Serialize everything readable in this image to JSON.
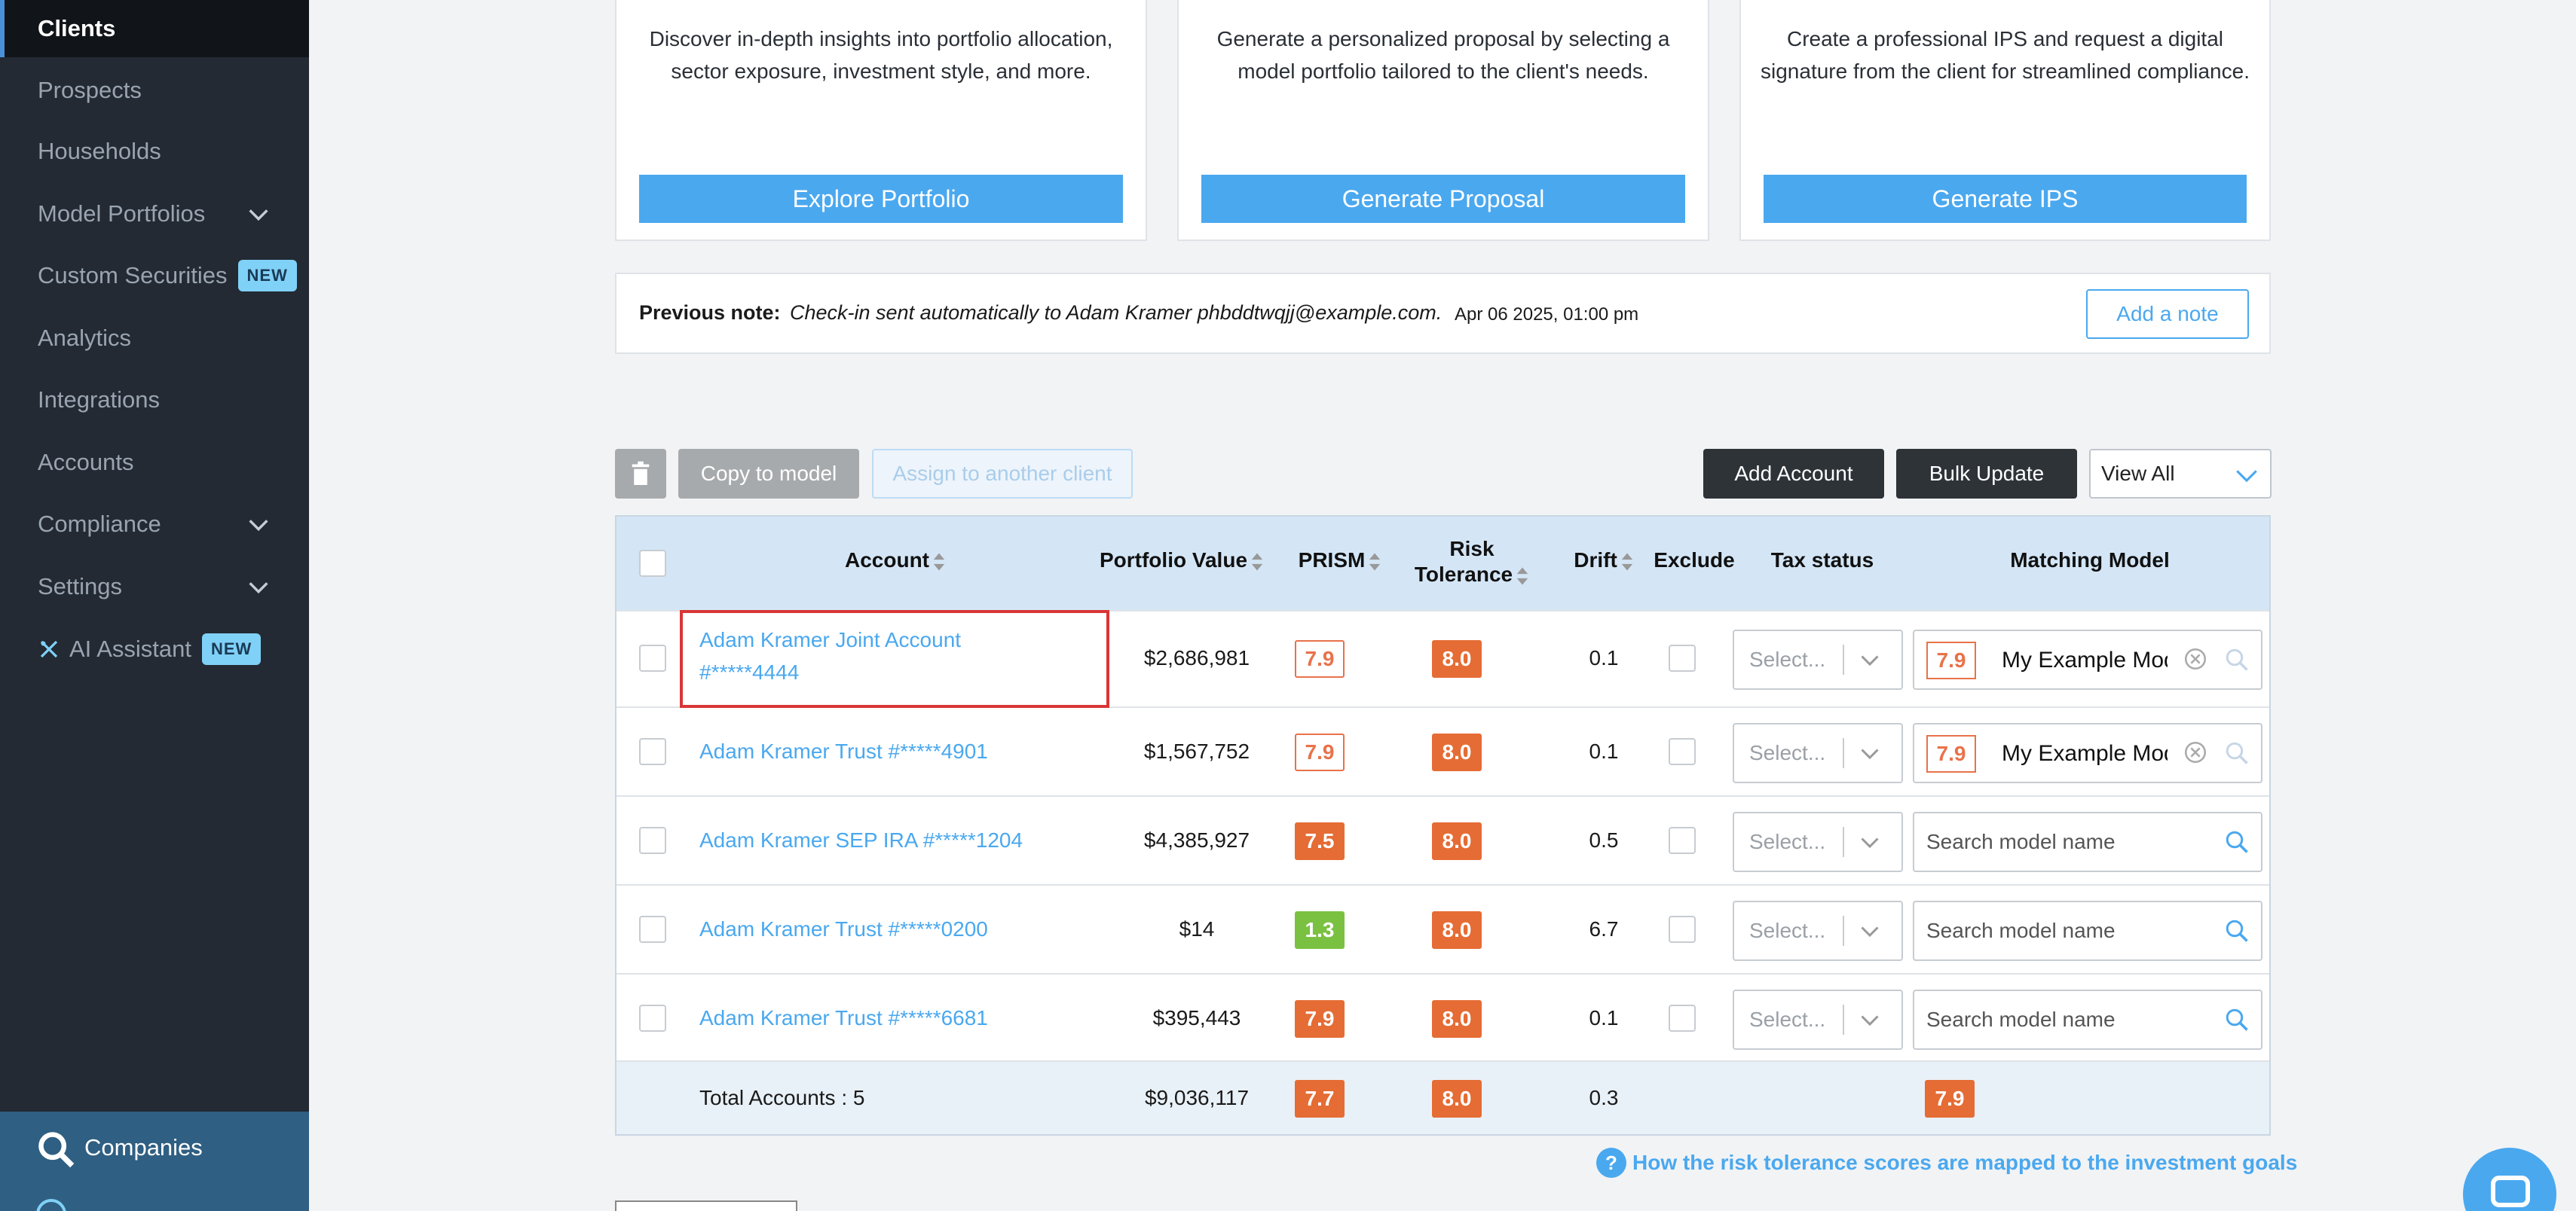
{
  "sidebar": {
    "items": [
      {
        "label": "Clients",
        "active": true
      },
      {
        "label": "Prospects"
      },
      {
        "label": "Households"
      },
      {
        "label": "Model Portfolios"
      },
      {
        "label": "Custom Securities",
        "badge": "NEW"
      },
      {
        "label": "Analytics"
      },
      {
        "label": "Integrations"
      },
      {
        "label": "Accounts"
      },
      {
        "label": "Compliance"
      },
      {
        "label": "Settings"
      },
      {
        "label": "AI Assistant",
        "badge": "NEW"
      }
    ],
    "companies_label": "Companies"
  },
  "cards": [
    {
      "description": "Discover in-depth insights into portfolio allocation, sector exposure, investment style, and more.",
      "button": "Explore Portfolio"
    },
    {
      "description": "Generate a personalized proposal by selecting a model portfolio tailored to the client's needs.",
      "button": "Generate Proposal"
    },
    {
      "description": "Create a professional IPS and request a digital signature from the client for streamlined compliance.",
      "button": "Generate IPS"
    }
  ],
  "note": {
    "label": "Previous note:",
    "text": "Check-in sent automatically to Adam Kramer phbddtwqjj@example.com.",
    "date": "Apr 06 2025, 01:00 pm",
    "add_button": "Add a note"
  },
  "toolbar": {
    "copy": "Copy to model",
    "assign": "Assign to another client",
    "add_account": "Add Account",
    "bulk_update": "Bulk Update",
    "view_select": "View All"
  },
  "table": {
    "headers": {
      "account": "Account",
      "portfolio_value": "Portfolio Value",
      "prism": "PRISM",
      "risk_line1": "Risk",
      "risk_line2": "Tolerance",
      "drift": "Drift",
      "exclude": "Exclude",
      "tax_status": "Tax status",
      "matching_model": "Matching Model"
    },
    "rows": [
      {
        "account": "Adam Kramer Joint Account #*****4444",
        "value": "$2,686,981",
        "prism": "7.9",
        "risk": "8.0",
        "drift": "0.1",
        "tax": "Select...",
        "model_score": "7.9",
        "model_name": "My Example Model"
      },
      {
        "account": "Adam Kramer Trust #*****4901",
        "value": "$1,567,752",
        "prism": "7.9",
        "risk": "8.0",
        "drift": "0.1",
        "tax": "Select...",
        "model_score": "7.9",
        "model_name": "My Example Model"
      },
      {
        "account": "Adam Kramer SEP IRA #*****1204",
        "value": "$4,385,927",
        "prism": "7.5",
        "risk": "8.0",
        "drift": "0.5",
        "tax": "Select...",
        "model_placeholder": "Search model name"
      },
      {
        "account": "Adam Kramer Trust #*****0200",
        "value": "$14",
        "prism": "1.3",
        "risk": "8.0",
        "drift": "6.7",
        "tax": "Select...",
        "model_placeholder": "Search model name"
      },
      {
        "account": "Adam Kramer Trust #*****6681",
        "value": "$395,443",
        "prism": "7.9",
        "risk": "8.0",
        "drift": "0.1",
        "tax": "Select...",
        "model_placeholder": "Search model name"
      }
    ],
    "totals": {
      "label": "Total Accounts : 5",
      "value": "$9,036,117",
      "prism": "7.7",
      "risk": "8.0",
      "drift": "0.3",
      "model_score": "7.9"
    }
  },
  "risk_link": "How the risk tolerance scores are mapped to the investment goals",
  "colors": {
    "accent": "#4aa8ef",
    "sidebar": "#232a33",
    "score_orange": "#e56c34",
    "score_green": "#7ac142"
  }
}
